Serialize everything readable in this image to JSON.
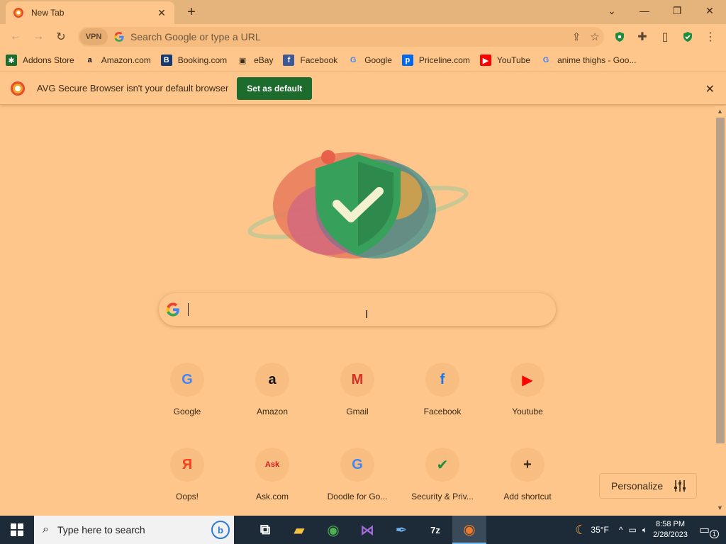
{
  "tab": {
    "title": "New Tab",
    "close": "✕",
    "new_tab": "+"
  },
  "window": {
    "dropdown": "⌄",
    "minimize": "—",
    "restore": "❐",
    "close": "✕"
  },
  "toolbar": {
    "back": "←",
    "forward": "→",
    "reload": "↻",
    "vpn": "VPN",
    "omnibox_placeholder": "Search Google or type a URL",
    "share": "⇪",
    "star": "☆",
    "extensions": "✚",
    "sidepanel": "▯",
    "menu": "⋮"
  },
  "bookmarks": [
    {
      "label": "Addons Store",
      "icon": "addons-icon",
      "glyph": "✱",
      "bg": "#1e6b2e",
      "fg": "#ffffff"
    },
    {
      "label": "Amazon.com",
      "icon": "amazon-icon",
      "glyph": "a",
      "bg": "transparent",
      "fg": "#111111"
    },
    {
      "label": "Booking.com",
      "icon": "booking-icon",
      "glyph": "B",
      "bg": "#163a6e",
      "fg": "#ffffff"
    },
    {
      "label": "eBay",
      "icon": "ebay-icon",
      "glyph": "▣",
      "bg": "transparent",
      "fg": "#3a2a18"
    },
    {
      "label": "Facebook",
      "icon": "facebook-icon",
      "glyph": "f",
      "bg": "#3b5998",
      "fg": "#ffffff"
    },
    {
      "label": "Google",
      "icon": "google-icon",
      "glyph": "G",
      "bg": "transparent",
      "fg": "#4285f4"
    },
    {
      "label": "Priceline.com",
      "icon": "priceline-icon",
      "glyph": "p",
      "bg": "#0068ef",
      "fg": "#ffffff"
    },
    {
      "label": "YouTube",
      "icon": "youtube-icon",
      "glyph": "▶",
      "bg": "#ff0000",
      "fg": "#ffffff"
    },
    {
      "label": "anime thighs - Goo...",
      "icon": "google-icon",
      "glyph": "G",
      "bg": "transparent",
      "fg": "#4285f4"
    }
  ],
  "infobar": {
    "message": "AVG Secure Browser isn't your default browser",
    "button": "Set as default",
    "close": "✕"
  },
  "search": {
    "placeholder": ""
  },
  "shortcuts": [
    {
      "label": "Google",
      "icon": "google-icon",
      "glyph": "G",
      "color": "#4285f4"
    },
    {
      "label": "Amazon",
      "icon": "amazon-icon",
      "glyph": "a",
      "color": "#111111"
    },
    {
      "label": "Gmail",
      "icon": "gmail-icon",
      "glyph": "M",
      "color": "#d93025"
    },
    {
      "label": "Facebook",
      "icon": "facebook-icon",
      "glyph": "f",
      "color": "#1877f2"
    },
    {
      "label": "Youtube",
      "icon": "youtube-icon",
      "glyph": "▶",
      "color": "#ff0000"
    },
    {
      "label": "Oops!",
      "icon": "yandex-icon",
      "glyph": "Я",
      "color": "#fc3f1d"
    },
    {
      "label": "Ask.com",
      "icon": "ask-icon",
      "glyph": "Ask",
      "color": "#d5191c"
    },
    {
      "label": "Doodle for Go...",
      "icon": "google-icon",
      "glyph": "G",
      "color": "#4285f4"
    },
    {
      "label": "Security & Priv...",
      "icon": "shield-icon",
      "glyph": "✔",
      "color": "#1e8e3e"
    },
    {
      "label": "Add shortcut",
      "icon": "plus-icon",
      "glyph": "+",
      "color": "#3a2a18"
    }
  ],
  "personalize": {
    "label": "Personalize"
  },
  "taskbar": {
    "search_placeholder": "Type here to search",
    "apps": [
      {
        "name": "task-view",
        "glyph": "⧉",
        "color": "#ffffff"
      },
      {
        "name": "file-explorer",
        "glyph": "▰",
        "color": "#f5c342"
      },
      {
        "name": "chrome",
        "glyph": "◉",
        "color": "#4caf50"
      },
      {
        "name": "visual-studio",
        "glyph": "⋈",
        "color": "#a26bd6"
      },
      {
        "name": "tool-app",
        "glyph": "✒",
        "color": "#6fb0e6"
      },
      {
        "name": "7zip",
        "glyph": "7z",
        "color": "#ffffff"
      },
      {
        "name": "avg-browser",
        "glyph": "◉",
        "color": "#f07a2a"
      }
    ],
    "weather": "35°F",
    "time": "8:58 PM",
    "date": "2/28/2023",
    "notification_count": "1"
  },
  "colors": {
    "accent": "#1e6b2e",
    "page_bg": "#fec68a",
    "taskbar": "#1d2b38"
  }
}
